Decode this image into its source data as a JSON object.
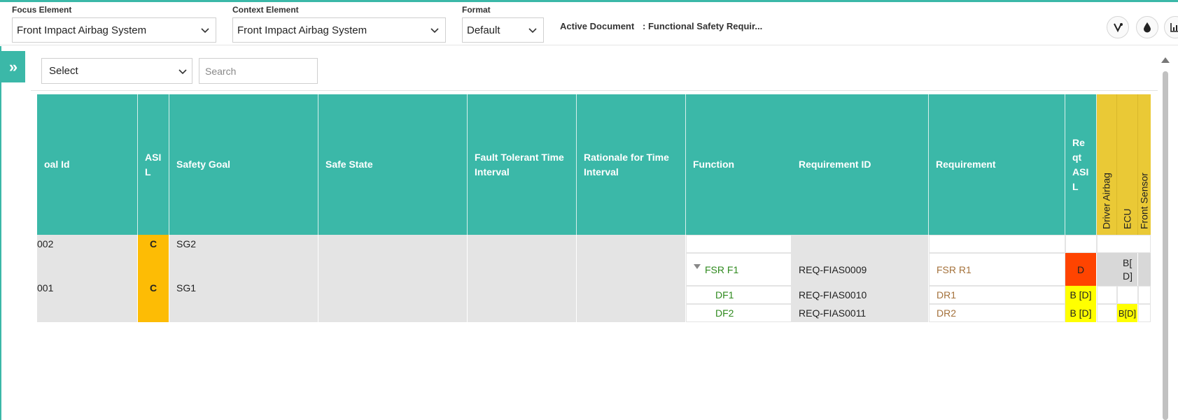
{
  "toolbar": {
    "focus_label": "Focus Element",
    "focus_value": "Front Impact Airbag System",
    "context_label": "Context Element",
    "context_value": "Front Impact Airbag System",
    "format_label": "Format",
    "format_value": "Default",
    "active_doc_label": "Active Document",
    "active_doc_value": ": Functional Safety Requir...",
    "icons": [
      "graph-icon",
      "drop-icon",
      "chart-icon"
    ]
  },
  "filter": {
    "select_value": "Select",
    "search_placeholder": "Search"
  },
  "table": {
    "headers": {
      "goal_id": "oal Id",
      "asil": "ASI L",
      "safety_goal": "Safety Goal",
      "safe_state": "Safe State",
      "ftti": "Fault Tolerant Time Interval",
      "rationale": "Rationale for Time Interval",
      "function": "Function",
      "requirement_id": "Requirement ID",
      "requirement": "Requirement",
      "reqt_asil": "Re qt ASI L",
      "driver_airbag": "Driver Airbag",
      "ecu": "ECU",
      "front_sensor": "Front Sensor"
    },
    "goals": [
      {
        "goal_id": "002",
        "asil": "C",
        "safety_goal": "SG2"
      },
      {
        "goal_id": "001",
        "asil": "C",
        "safety_goal": "SG1"
      }
    ],
    "requirements": [
      {
        "function": "FSR F1",
        "requirement_id": "REQ-FIAS0009",
        "requirement": "FSR R1",
        "reqt_asil": "D",
        "ecu": "B[ D]"
      },
      {
        "function": "DF1",
        "requirement_id": "REQ-FIAS0010",
        "requirement": "DR1",
        "reqt_asil": "B [D]"
      },
      {
        "function": "DF2",
        "requirement_id": "REQ-FIAS0011",
        "requirement": "DR2",
        "reqt_asil": "B [D]",
        "ecu": "B[D]"
      }
    ],
    "colors": {
      "header": "#3bb8a8",
      "allocation_header": "#eac936",
      "asil_c": "#fdbc05",
      "asil_d": "#ff4400",
      "asil_b": "#ffff00",
      "function_text": "#2f8a1e",
      "requirement_text": "#a4713b"
    }
  }
}
